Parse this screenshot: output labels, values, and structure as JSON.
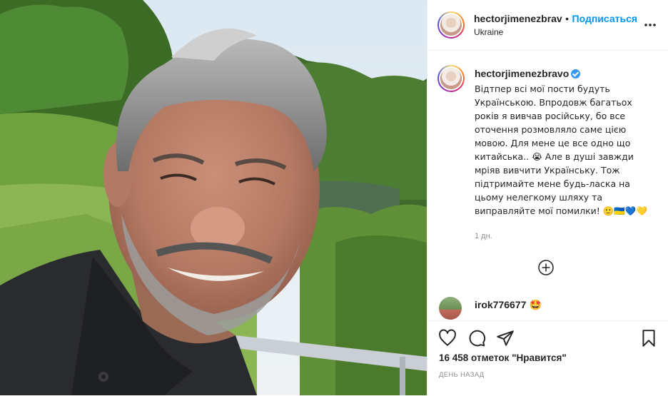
{
  "post": {
    "image_alt": "Selfie of a man with grey hair and beard in a dark chef jacket, green hills behind"
  },
  "header": {
    "username": "hectorjimenezbrav",
    "separator": "•",
    "follow_label": "Подписаться",
    "location": "Ukraine",
    "more_icon": "more-horizontal-icon"
  },
  "caption": {
    "username": "hectorjimenezbravo",
    "verified": true,
    "text": "Відтпер всі мої пости будуть Українською. Впродовж багатьох років я вивчав російську, бо все оточення розмовляло саме цією мовою. Для мене це все одно що китайська.. 😭 Але в душі завжди мріяв вивчити Українську. Тож підтримайте мене будь-ласка на цьому нелегкому шляху та виправляйте мої помилки! 🙂🇺🇦💙💛",
    "time": "1 дн."
  },
  "load_more_icon": "plus-circle-icon",
  "comment": {
    "username": "irok776677",
    "text": "🤩"
  },
  "actions": {
    "like_icon": "heart-icon",
    "comment_icon": "comment-icon",
    "share_icon": "send-icon",
    "save_icon": "bookmark-icon"
  },
  "likes_text": "16 458 отметок \"Нравится\"",
  "posted_text": "ДЕНЬ НАЗАД",
  "colors": {
    "accent": "#0095f6",
    "text": "#262626",
    "muted": "#8e8e8e",
    "border": "#efefef"
  }
}
